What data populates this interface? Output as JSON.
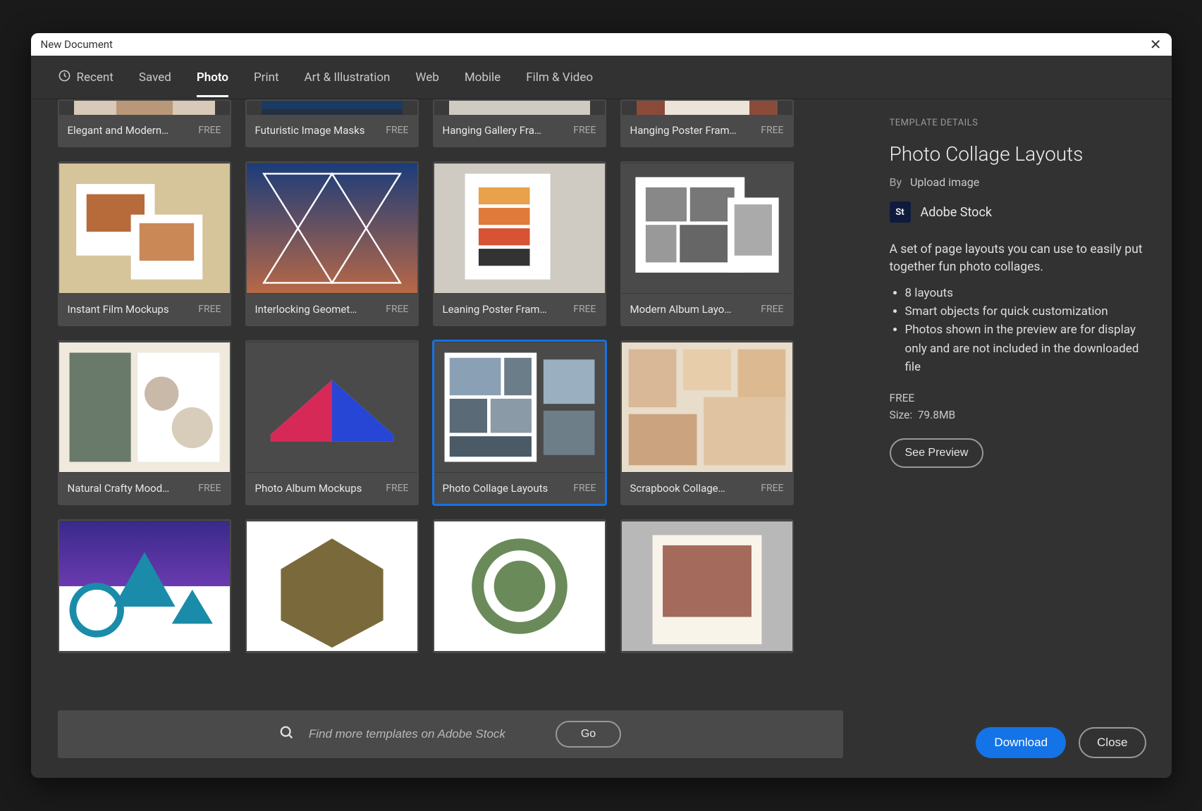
{
  "window": {
    "title": "New Document"
  },
  "tabs": [
    {
      "label": "Recent"
    },
    {
      "label": "Saved"
    },
    {
      "label": "Photo"
    },
    {
      "label": "Print"
    },
    {
      "label": "Art & Illustration"
    },
    {
      "label": "Web"
    },
    {
      "label": "Mobile"
    },
    {
      "label": "Film & Video"
    }
  ],
  "active_tab": "Photo",
  "templates": [
    {
      "name": "Elegant and Modern…",
      "price": "FREE"
    },
    {
      "name": "Futuristic Image Masks",
      "price": "FREE"
    },
    {
      "name": "Hanging Gallery Fra…",
      "price": "FREE"
    },
    {
      "name": "Hanging Poster Fram…",
      "price": "FREE"
    },
    {
      "name": "Instant Film Mockups",
      "price": "FREE"
    },
    {
      "name": "Interlocking Geomet…",
      "price": "FREE"
    },
    {
      "name": "Leaning Poster Fram…",
      "price": "FREE"
    },
    {
      "name": "Modern Album Layo…",
      "price": "FREE"
    },
    {
      "name": "Natural Crafty Mood…",
      "price": "FREE"
    },
    {
      "name": "Photo Album Mockups",
      "price": "FREE"
    },
    {
      "name": "Photo Collage Layouts",
      "price": "FREE",
      "selected": true
    },
    {
      "name": "Scrapbook Collage…",
      "price": "FREE"
    },
    {
      "name": "",
      "price": ""
    },
    {
      "name": "",
      "price": ""
    },
    {
      "name": "",
      "price": ""
    },
    {
      "name": "",
      "price": ""
    }
  ],
  "search": {
    "placeholder": "Find more templates on Adobe Stock",
    "go": "Go"
  },
  "details": {
    "section_label": "TEMPLATE DETAILS",
    "title": "Photo Collage Layouts",
    "by_label": "By",
    "author": "Upload image",
    "stock_badge": "St",
    "stock_name": "Adobe Stock",
    "description": "A set of page layouts you can use to easily put together fun photo collages.",
    "bullets": [
      "8 layouts",
      "Smart objects for quick customization",
      "Photos shown in the preview are for display only and are not included in the downloaded file"
    ],
    "price": "FREE",
    "size_label": "Size:",
    "size_value": "79.8MB",
    "preview_btn": "See Preview"
  },
  "footer": {
    "download": "Download",
    "close": "Close"
  }
}
